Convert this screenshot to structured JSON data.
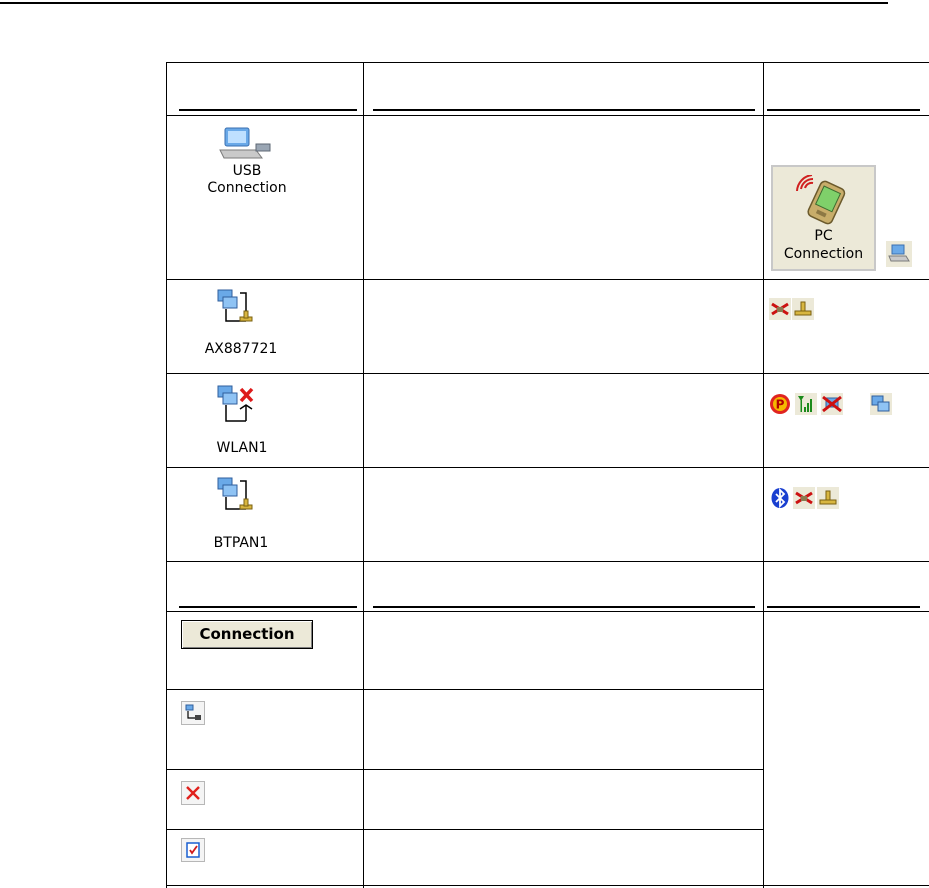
{
  "adapters": [
    {
      "name": "usb",
      "label_line1": "USB",
      "label_line2": "Connection"
    },
    {
      "name": "ax887721",
      "label": "AX887721"
    },
    {
      "name": "wlan1",
      "label": "WLAN1"
    },
    {
      "name": "btpan1",
      "label": "BTPAN1"
    }
  ],
  "pc_connection": {
    "line1": "PC",
    "line2": "Connection"
  },
  "toolbar": {
    "connection_label": "Connection"
  },
  "status_icons": {
    "ax887721": [
      "disconnected-icon",
      "network-connected-icon"
    ],
    "wlan1": [
      "p-icon",
      "signal-strength-icon",
      "wlan-disconnected-icon",
      "wlan-connected-icon"
    ],
    "btpan1": [
      "bluetooth-icon",
      "disconnected-icon",
      "network-connected-icon"
    ]
  },
  "colors": {
    "border": "#000000",
    "button_face": "#ece9d8",
    "red": "#e0201c",
    "blue": "#1a5fd0"
  }
}
